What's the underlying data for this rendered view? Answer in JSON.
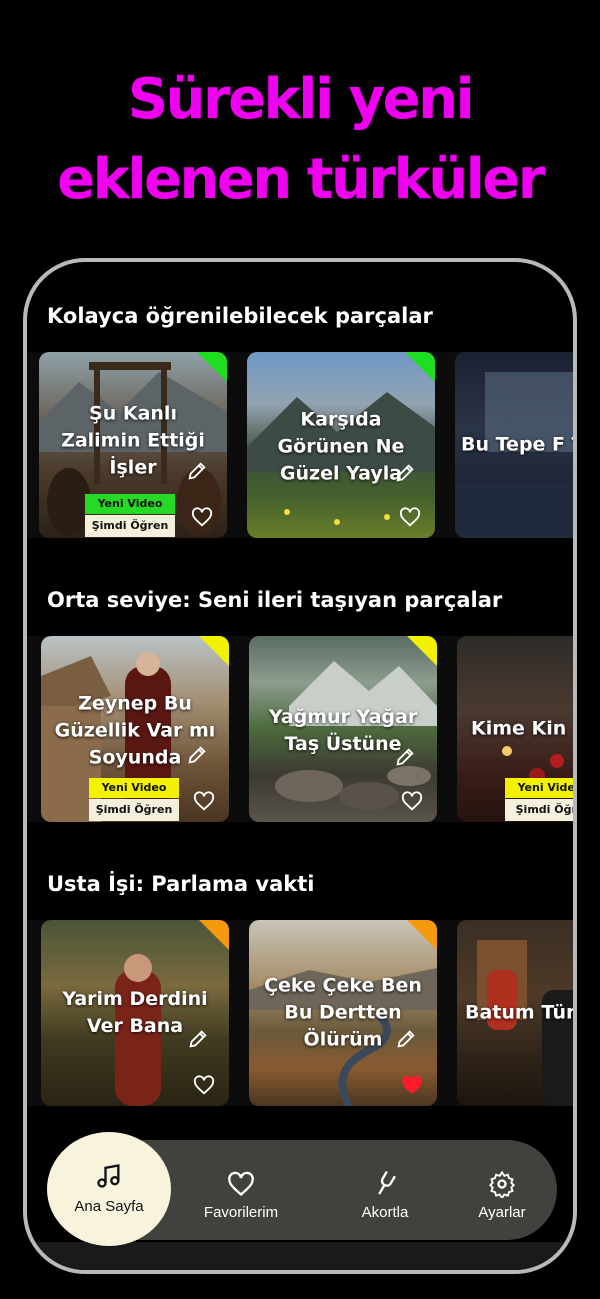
{
  "headline": {
    "line1": "Sürekli yeni",
    "line2": "eklenen türküler"
  },
  "sections": [
    {
      "title": "Kolayca öğrenilebilecek parçalar",
      "cards": [
        {
          "title": "Şu Kanlı Zalimin Ettiği İşler",
          "corner_color": "#1fdd1f",
          "badge_new": "Yeni Video",
          "badge_new_color": "#25d925",
          "badge_learn": "Şimdi Öğren",
          "favorited": false
        },
        {
          "title": "Karşıda Görünen Ne Güzel Yayla",
          "corner_color": "#1fdd1f",
          "favorited": false
        },
        {
          "title": "Bu Tepe F Tepe",
          "favorited": false
        }
      ]
    },
    {
      "title": "Orta seviye: Seni ileri taşıyan parçalar",
      "cards": [
        {
          "title": "Zeynep Bu Güzellik Var mı Soyunda",
          "corner_color": "#f2f200",
          "badge_new": "Yeni Video",
          "badge_new_color": "#f2f200",
          "badge_learn": "Şimdi Öğren",
          "favorited": false
        },
        {
          "title": "Yağmur Yağar Taş Üstüne",
          "corner_color": "#f2f200",
          "favorited": false
        },
        {
          "title": "Kime Kin",
          "badge_new": "Yeni Video",
          "badge_new_color": "#f2f200",
          "badge_learn": "Şimdi Öğre",
          "favorited": false
        }
      ]
    },
    {
      "title": "Usta İşi: Parlama vakti",
      "cards": [
        {
          "title": "Yarim Derdini Ver Bana",
          "corner_color": "#f59a0c",
          "favorited": false
        },
        {
          "title": "Çeke Çeke Ben Bu Dertten Ölürüm",
          "corner_color": "#f59a0c",
          "favorited": true
        },
        {
          "title": "Batum Tür",
          "favorited": false
        }
      ]
    }
  ],
  "nav": [
    {
      "label": "Ana Sayfa",
      "icon": "music-note-icon",
      "active": true
    },
    {
      "label": "Favorilerim",
      "icon": "heart-icon",
      "active": false
    },
    {
      "label": "Akortla",
      "icon": "tuning-fork-icon",
      "active": false
    },
    {
      "label": "Ayarlar",
      "icon": "gear-icon",
      "active": false
    }
  ],
  "colors": {
    "headline": "#f000f0",
    "heart_active": "#ff1a2a",
    "nav_active_bg": "#f8f3dd"
  }
}
